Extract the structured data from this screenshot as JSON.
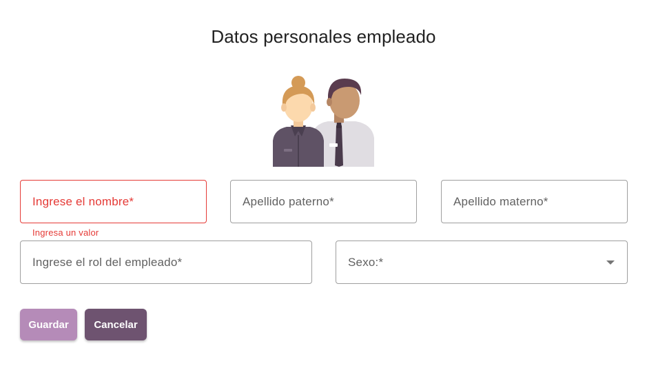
{
  "page": {
    "title": "Datos personales empleado"
  },
  "illustration": {
    "icon": "employees-illustration"
  },
  "form": {
    "nombre": {
      "label": "Ingrese el nombre*",
      "helper": "Ingresa un valor",
      "state": "error"
    },
    "apellido_paterno": {
      "label": "Apellido paterno*"
    },
    "apellido_materno": {
      "label": "Apellido materno*"
    },
    "rol": {
      "label": "Ingrese el rol del empleado*"
    },
    "sexo": {
      "label": "Sexo:*",
      "icon": "chevron-down-icon"
    }
  },
  "actions": {
    "save_label": "Guardar",
    "cancel_label": "Cancelar"
  },
  "colors": {
    "error": "#e53935",
    "border": "#9e9e9e",
    "save_button": "#b58bb8",
    "cancel_button": "#6e5370"
  }
}
